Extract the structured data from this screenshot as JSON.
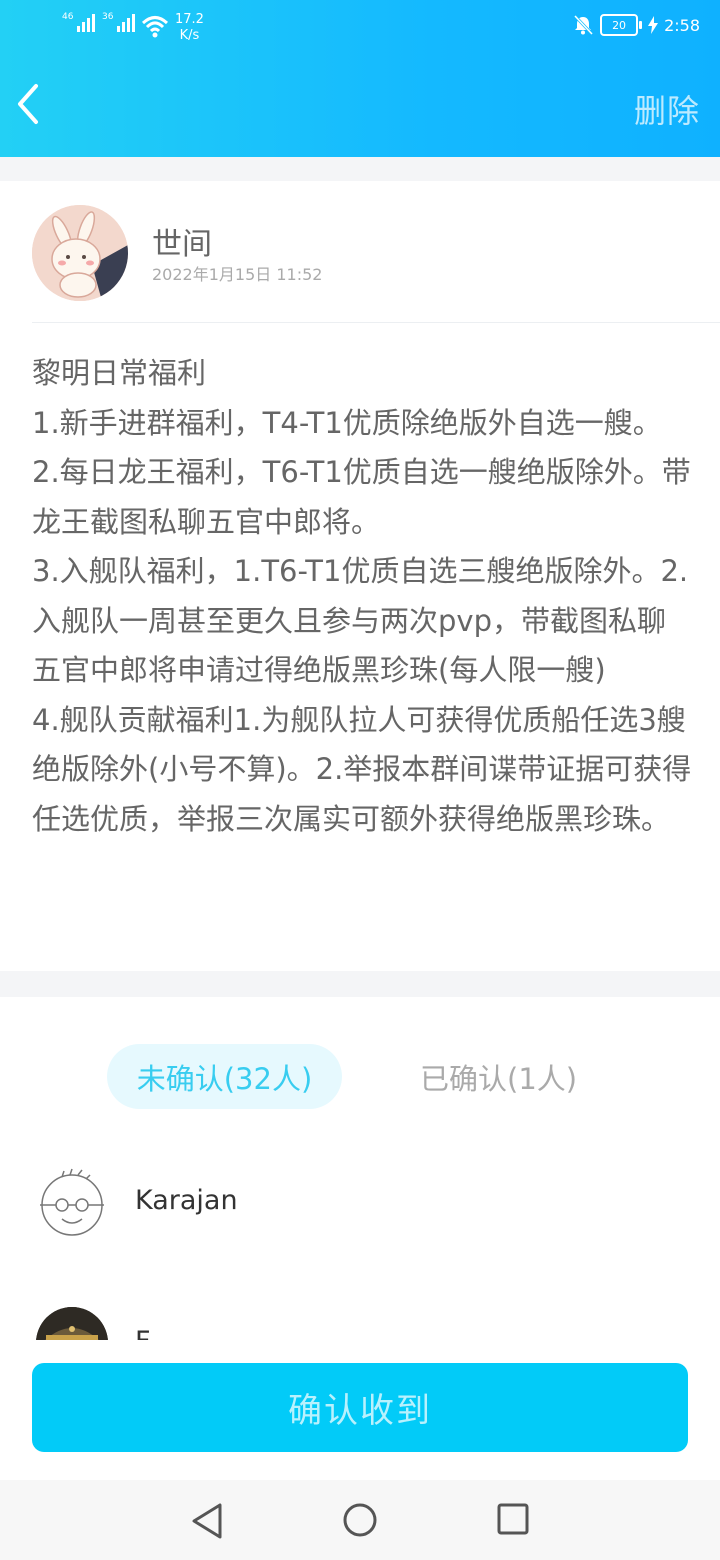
{
  "status_bar": {
    "sim1": "46",
    "sim2": "36",
    "speed_value": "17.2",
    "speed_unit": "K/s",
    "battery": "20",
    "time": "2:58"
  },
  "header": {
    "delete_label": "删除"
  },
  "post": {
    "author": "世间",
    "date": "2022年1月15日  11:52",
    "lines": [
      "黎明日常福利",
      "1.新手进群福利，T4-T1优质除绝版外自选一艘。",
      "2.每日龙王福利，T6-T1优质自选一艘绝版除外。带龙王截图私聊五官中郎将。",
      "3.入舰队福利，1.T6-T1优质自选三艘绝版除外。2.入舰队一周甚至更久且参与两次pvp，带截图私聊五官中郎将申请过得绝版黑珍珠(每人限一艘)",
      "4.舰队贡献福利1.为舰队拉人可获得优质船任选3艘绝版除外(小号不算)。2.举报本群间谍带证据可获得任选优质，举报三次属实可额外获得绝版黑珍珠。"
    ]
  },
  "tabs": {
    "unconfirmed": "未确认(32人)",
    "confirmed": "已确认(1人)"
  },
  "members": [
    {
      "name": "Karajan"
    },
    {
      "name": "F...."
    }
  ],
  "confirm_button": "确认收到",
  "colors": {
    "header_start": "#23d0f5",
    "header_end": "#0fb1ff",
    "button": "#02cbf8",
    "tab_active_bg": "#e6f9fe",
    "tab_active_text": "#38cdf0"
  }
}
